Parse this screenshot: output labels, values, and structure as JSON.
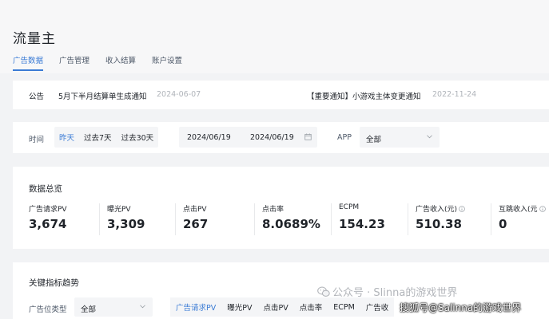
{
  "header": {
    "title": "流量主",
    "tabs": [
      {
        "label": "广告数据",
        "active": true
      },
      {
        "label": "广告管理",
        "active": false
      },
      {
        "label": "收入结算",
        "active": false
      },
      {
        "label": "账户设置",
        "active": false
      }
    ]
  },
  "notice": {
    "label": "公告",
    "items": [
      {
        "text": "5月下半月结算单生成通知",
        "date": "2024-06-07"
      },
      {
        "text": "【重要通知】小游戏主体变更通知",
        "date": "2022-11-24"
      }
    ]
  },
  "filters": {
    "time_label": "时间",
    "quick_ranges": [
      {
        "label": "昨天",
        "active": true
      },
      {
        "label": "过去7天",
        "active": false
      },
      {
        "label": "过去30天",
        "active": false
      }
    ],
    "date_start": "2024/06/19",
    "date_end": "2024/06/19",
    "app_label": "APP",
    "app_value": "全部"
  },
  "overview": {
    "title": "数据总览",
    "metrics": [
      {
        "label": "广告请求PV",
        "value": "3,674",
        "info": false
      },
      {
        "label": "曝光PV",
        "value": "3,309",
        "info": false
      },
      {
        "label": "点击PV",
        "value": "267",
        "info": false
      },
      {
        "label": "点击率",
        "value": "8.0689%",
        "info": false
      },
      {
        "label": "ECPM",
        "value": "154.23",
        "info": false
      },
      {
        "label": "广告收入(元)",
        "value": "510.38",
        "info": true
      },
      {
        "label": "互跳收入(元",
        "value": "0",
        "info": true
      }
    ]
  },
  "trend": {
    "title": "关键指标趋势",
    "type_label": "广告位类型",
    "type_value": "全部",
    "metric_tabs": [
      {
        "label": "广告请求PV",
        "active": true
      },
      {
        "label": "曝光PV",
        "active": false
      },
      {
        "label": "点击PV",
        "active": false
      },
      {
        "label": "点击率",
        "active": false
      },
      {
        "label": "ECPM",
        "active": false
      },
      {
        "label": "广告收",
        "active": false
      }
    ]
  },
  "watermarks": {
    "wechat": "公众号 · Slinna的游戏世界",
    "sohu": "搜狐号@Salinna的游戏世界"
  },
  "colors": {
    "accent": "#3a7bd5",
    "page_bg": "#f2f3f5",
    "card_bg": "#ffffff"
  },
  "icons": {
    "calendar": "calendar-icon",
    "chevron": "chevron-down-icon",
    "info": "info-icon",
    "wechat": "wechat-icon"
  }
}
